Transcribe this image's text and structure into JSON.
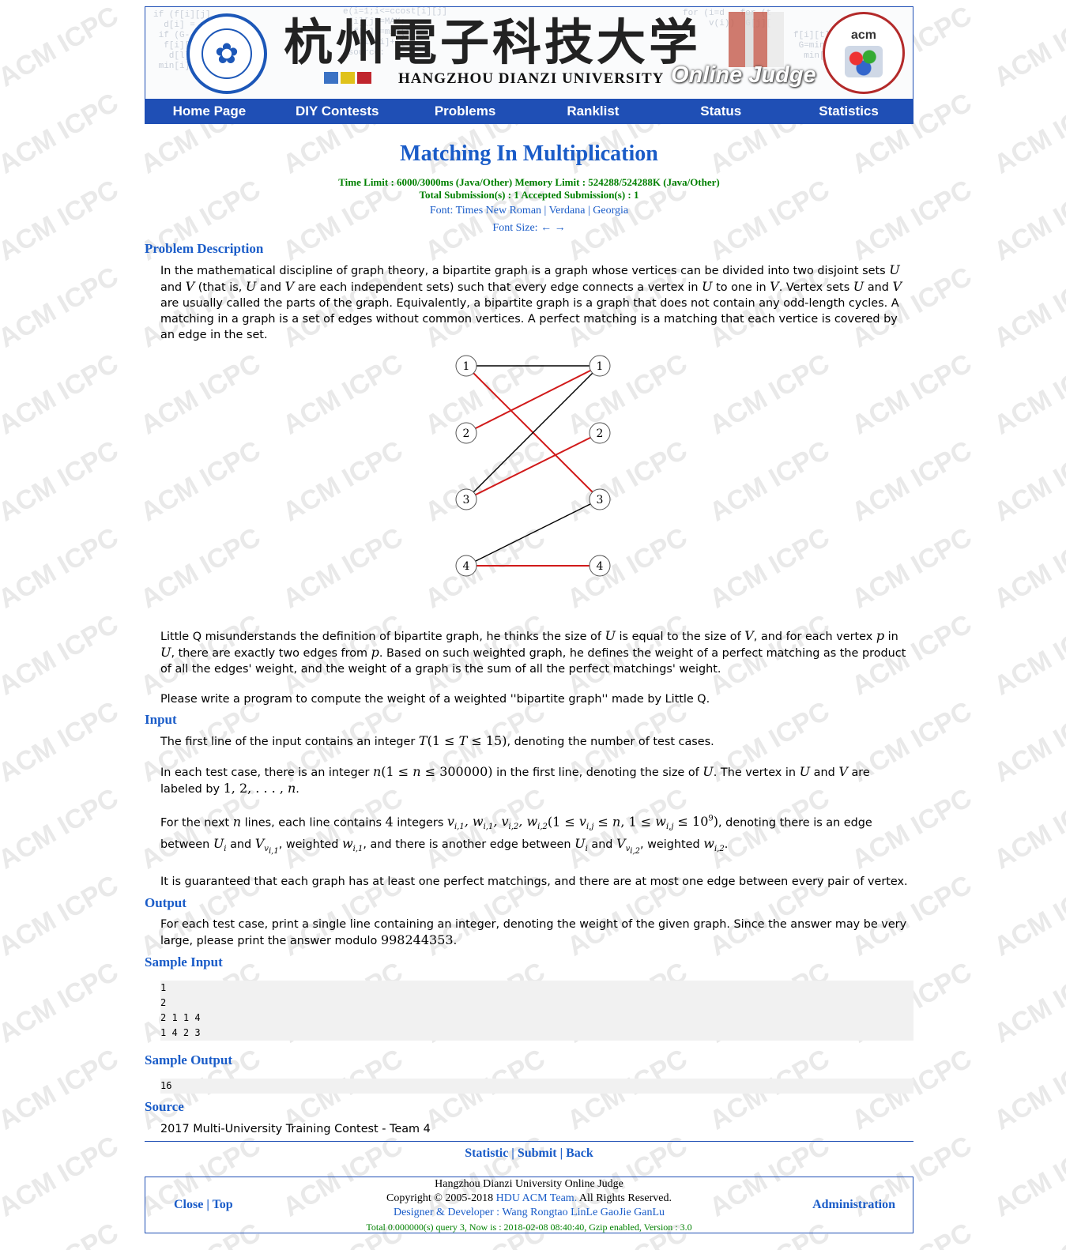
{
  "header": {
    "university_cn": "杭州電子科技大学",
    "university_en": "HANGZHOU DIANZI UNIVERSITY",
    "online_judge": "Online Judge",
    "acm_logo_text": "acm"
  },
  "nav": [
    "Home Page",
    "DIY Contests",
    "Problems",
    "Ranklist",
    "Status",
    "Statistics"
  ],
  "problem": {
    "title": "Matching In Multiplication",
    "limits_line1": "Time Limit : 6000/3000ms (Java/Other)   Memory Limit : 524288/524288K (Java/Other)",
    "limits_line2": "Total Submission(s) : 1   Accepted Submission(s) : 1",
    "font_label": "Font: ",
    "fonts": [
      "Times New Roman",
      "Verdana",
      "Georgia"
    ],
    "font_size_label": "Font Size: ← →"
  },
  "sections": {
    "description": "Problem Description",
    "input": "Input",
    "output": "Output",
    "sample_input": "Sample Input",
    "sample_output": "Sample Output",
    "source": "Source"
  },
  "graph": {
    "left_nodes": [
      "1",
      "2",
      "3",
      "4"
    ],
    "right_nodes": [
      "1",
      "2",
      "3"
    ],
    "right_node_4": "4",
    "edge_color_black": "#000000",
    "edge_color_red": "#d11a1a"
  },
  "sample_input_lines": [
    "1",
    "2",
    "2 1 1 4",
    "1 4 2 3"
  ],
  "sample_output_lines": [
    "16"
  ],
  "source_text": "2017 Multi-University Training Contest - Team 4",
  "bottom_links": "Statistic | Submit | Back",
  "footer": {
    "left": "Close | Top",
    "right": "Administration",
    "line1": "Hangzhou Dianzi University Online Judge",
    "line2a": "Copyright © 2005-2018 ",
    "line2b": "HDU ACM Team.",
    "line2c": " All Rights Reserved.",
    "line3": "Designer & Developer : Wang Rongtao LinLe GaoJie GanLu",
    "line4": "Total 0.000000(s) query 3, Now is : 2018-02-08 08:40:40, Gzip enabled, Version : 3.0"
  },
  "watermark": "ACM   ICPC"
}
